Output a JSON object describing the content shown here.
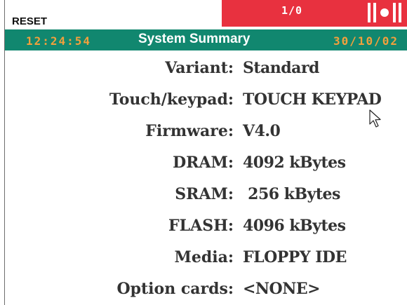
{
  "header": {
    "reset_label": "RESET",
    "alarm_count": "1/0",
    "time": "12:24:54",
    "title": "System Summary",
    "date": "30/10/02"
  },
  "colors": {
    "alarm_red": "#e8313f",
    "title_bar_green": "#11876f",
    "clock_orange": "#f2a03c"
  },
  "summary": {
    "variant": {
      "label": "Variant:",
      "value": "Standard"
    },
    "touch_keypad": {
      "label": "Touch/keypad:",
      "value": "TOUCH KEYPAD"
    },
    "firmware": {
      "label": "Firmware:",
      "value": "V4.0"
    },
    "dram": {
      "label": "DRAM:",
      "value": "4092 kBytes"
    },
    "sram": {
      "label": "SRAM:",
      "value": " 256 kBytes"
    },
    "flash": {
      "label": "FLASH:",
      "value": "4096 kBytes"
    },
    "media": {
      "label": "Media:",
      "value": "FLOPPY IDE"
    },
    "option_cards": {
      "label": "Option cards:",
      "value": "<NONE>"
    }
  },
  "icons": {
    "alarm": "alarm-bell-icon",
    "pointer": "mouse-pointer-icon"
  }
}
